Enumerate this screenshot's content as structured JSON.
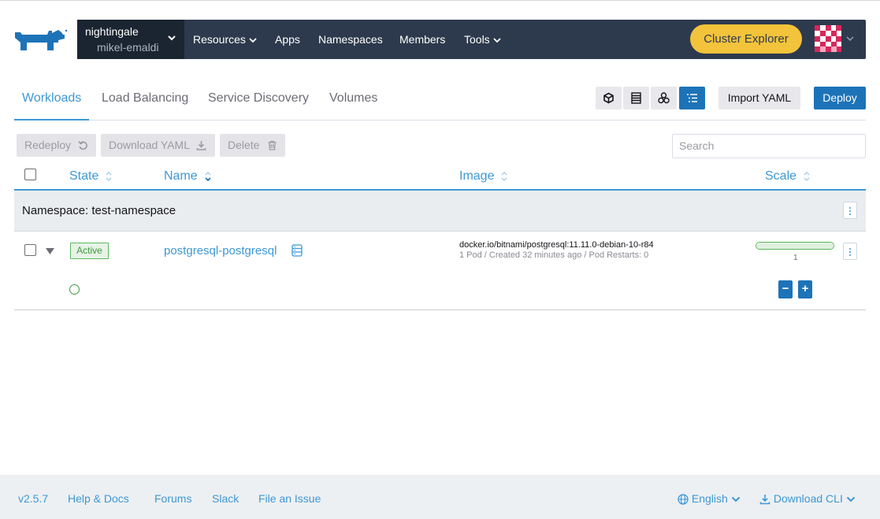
{
  "header": {
    "cluster_name": "nightingale",
    "project_name": "mikel-emaldi",
    "nav": [
      {
        "label": "Resources",
        "has_menu": true
      },
      {
        "label": "Apps",
        "has_menu": false
      },
      {
        "label": "Namespaces",
        "has_menu": false
      },
      {
        "label": "Members",
        "has_menu": false
      },
      {
        "label": "Tools",
        "has_menu": true
      }
    ],
    "cluster_explorer_label": "Cluster Explorer",
    "accent_color": "#f3c33b",
    "header_color": "#2d3a4d"
  },
  "tabs": [
    {
      "label": "Workloads",
      "active": true
    },
    {
      "label": "Load Balancing",
      "active": false
    },
    {
      "label": "Service Discovery",
      "active": false
    },
    {
      "label": "Volumes",
      "active": false
    }
  ],
  "toolbar": {
    "view_modes": [
      "cube-icon",
      "list-icon",
      "nodes-icon",
      "grouped-list-icon"
    ],
    "active_view": "grouped-list-icon",
    "import_label": "Import YAML",
    "deploy_label": "Deploy"
  },
  "bulk_actions": {
    "redeploy_label": "Redeploy",
    "download_label": "Download YAML",
    "delete_label": "Delete",
    "search_placeholder": "Search"
  },
  "table": {
    "columns": [
      "State",
      "Name",
      "Image",
      "Scale"
    ],
    "group_label": "Namespace: test-namespace",
    "rows": [
      {
        "state": "Active",
        "name": "postgresql-postgresql",
        "image": "docker.io/bitnami/postgresql:11.11.0-debian-10-r84",
        "detail": "1 Pod / Created 32 minutes ago / Pod Restarts: 0",
        "scale": "1"
      }
    ]
  },
  "footer": {
    "version": "v2.5.7",
    "help": "Help & Docs",
    "forums": "Forums",
    "slack": "Slack",
    "issue": "File an Issue",
    "language": "English",
    "download_cli": "Download CLI"
  }
}
